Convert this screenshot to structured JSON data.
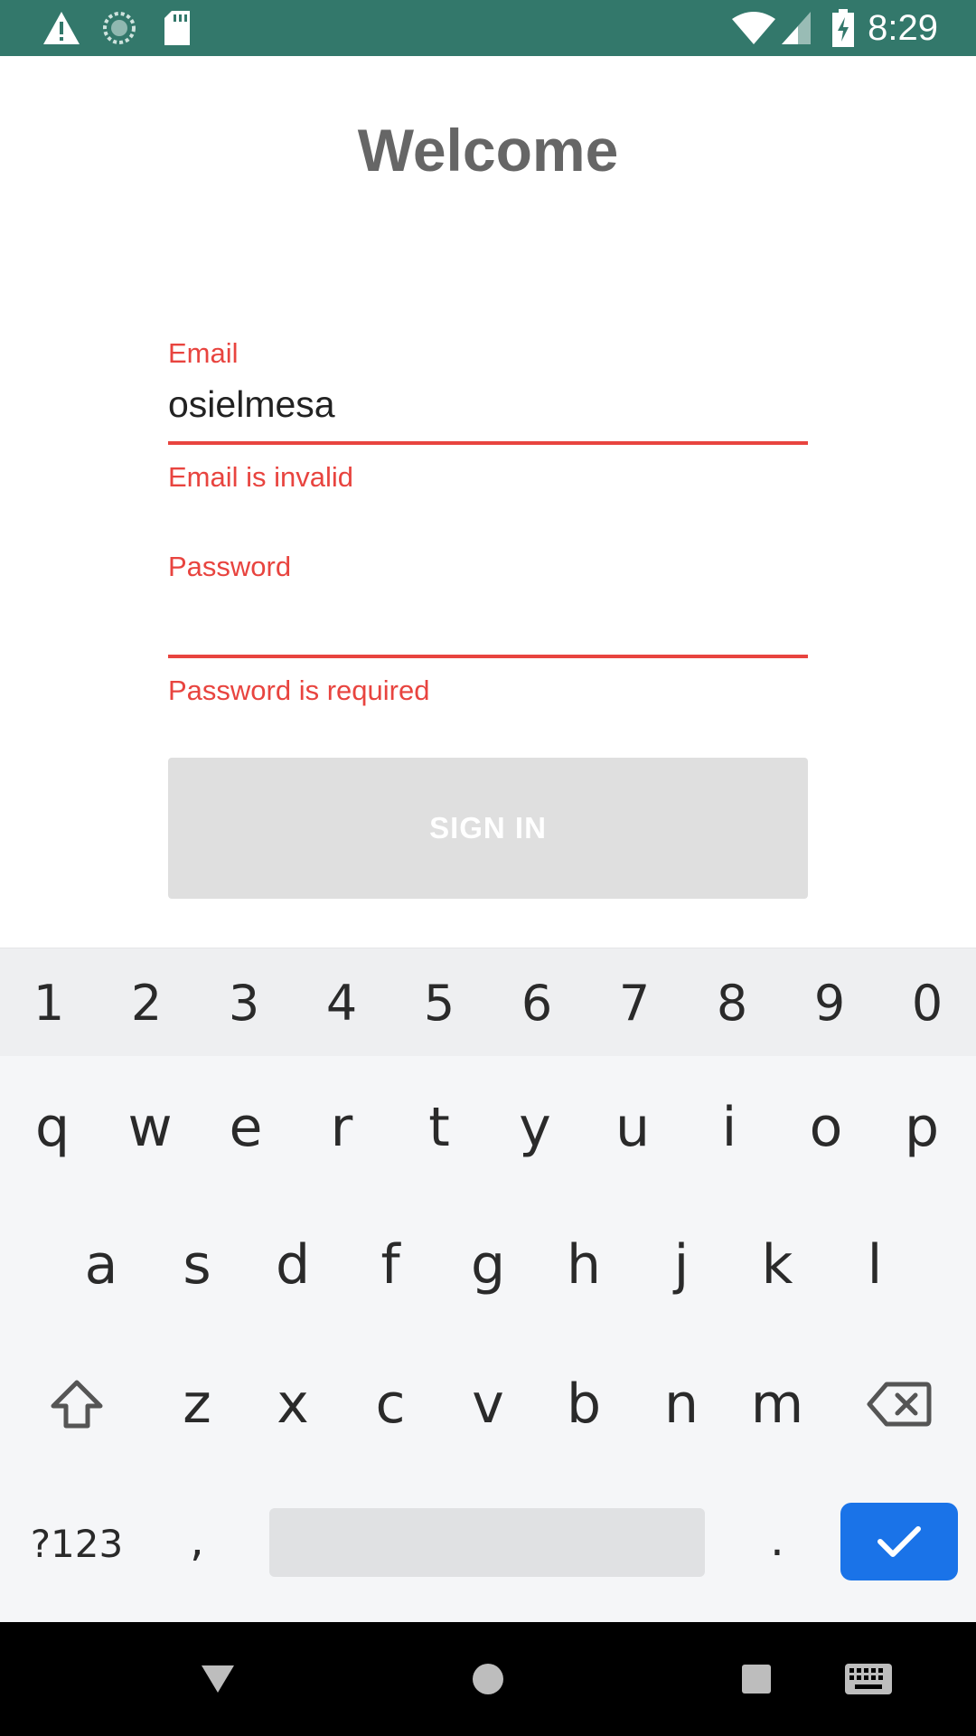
{
  "status_bar": {
    "time": "8:29",
    "icons": [
      "warning-icon",
      "sync-icon",
      "sd-card-icon",
      "wifi-icon",
      "cell-signal-icon",
      "battery-charging-icon"
    ]
  },
  "app": {
    "title": "Welcome",
    "email": {
      "label": "Email",
      "value": "osielmesa",
      "error": "Email is invalid"
    },
    "password": {
      "label": "Password",
      "value": "",
      "error": "Password is required"
    },
    "sign_in_label": "SIGN IN"
  },
  "keyboard": {
    "numbers": [
      "1",
      "2",
      "3",
      "4",
      "5",
      "6",
      "7",
      "8",
      "9",
      "0"
    ],
    "row1": [
      "q",
      "w",
      "e",
      "r",
      "t",
      "y",
      "u",
      "i",
      "o",
      "p"
    ],
    "row2": [
      "a",
      "s",
      "d",
      "f",
      "g",
      "h",
      "j",
      "k",
      "l"
    ],
    "row3": [
      "z",
      "x",
      "c",
      "v",
      "b",
      "n",
      "m"
    ],
    "symbols_label": "?123",
    "comma": ",",
    "period": "."
  },
  "nav_bar": {
    "icons": [
      "back-icon",
      "home-icon",
      "recents-icon",
      "keyboard-switch-icon"
    ]
  },
  "colors": {
    "status_bar": "#33786b",
    "error": "#e8443f",
    "enter_key": "#1a73e8"
  }
}
